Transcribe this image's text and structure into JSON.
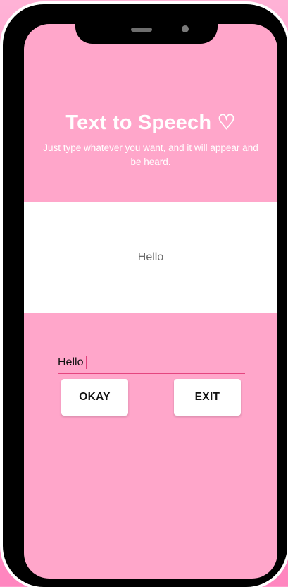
{
  "app": {
    "title": "Text to Speech ♡",
    "subtitle": "Just type whatever you want, and it will appear and be heard."
  },
  "display": {
    "text": "Hello"
  },
  "input": {
    "value": "Hello",
    "placeholder": ""
  },
  "buttons": {
    "okay_label": "OKAY",
    "exit_label": "EXIT"
  },
  "colors": {
    "background_pink": "#ffa6ca",
    "accent_underline": "#e5457f",
    "panel_white": "#ffffff"
  }
}
